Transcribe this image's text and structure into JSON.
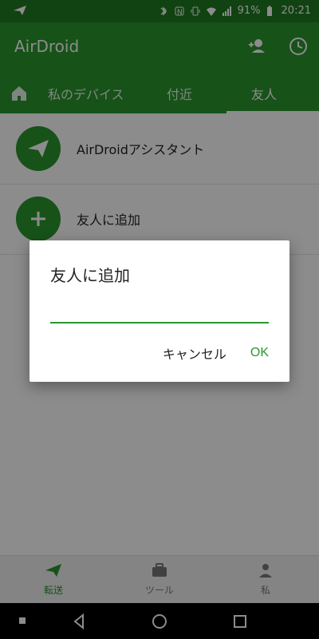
{
  "status": {
    "battery": "91%",
    "time": "20:21"
  },
  "appbar": {
    "title": "AirDroid",
    "icons": [
      "person-add-icon",
      "history-icon"
    ]
  },
  "tabs": [
    {
      "label": ""
    },
    {
      "label": "私のデバイス"
    },
    {
      "label": "付近"
    },
    {
      "label": "友人"
    }
  ],
  "list": {
    "items": [
      {
        "label": "AirDroidアシスタント",
        "icon": "paper-plane-icon"
      },
      {
        "label": "友人に追加",
        "icon": "plus-icon"
      }
    ]
  },
  "dialog": {
    "title": "友人に追加",
    "input_value": "",
    "cancel_label": "キャンセル",
    "ok_label": "OK"
  },
  "bottomnav": {
    "items": [
      {
        "label": "転送"
      },
      {
        "label": "ツール"
      },
      {
        "label": "私"
      }
    ]
  },
  "colors": {
    "primary": "#2a962f",
    "statusbar": "#1f7a22",
    "accent_text": "#2a962f"
  }
}
